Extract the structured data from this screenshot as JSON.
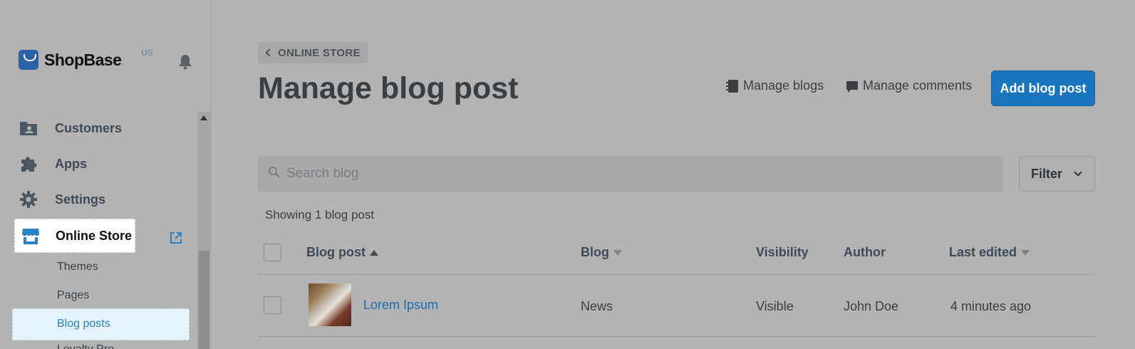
{
  "brand": {
    "name": "ShopBase",
    "region": "US"
  },
  "sidebar": {
    "items": [
      {
        "label": "Customers",
        "icon": "customers-icon"
      },
      {
        "label": "Apps",
        "icon": "apps-icon"
      },
      {
        "label": "Settings",
        "icon": "gear-icon"
      },
      {
        "label": "Online Store",
        "icon": "store-icon"
      }
    ],
    "subitems": [
      "Themes",
      "Pages",
      "Blog posts",
      "Loyalty Pro"
    ]
  },
  "header": {
    "back_label": "ONLINE STORE",
    "title": "Manage blog post",
    "manage_blogs": "Manage blogs",
    "manage_comments": "Manage comments",
    "add_button": "Add blog post"
  },
  "search": {
    "placeholder": "Search blog",
    "value": ""
  },
  "filter": {
    "label": "Filter"
  },
  "table": {
    "summary": "Showing 1 blog post",
    "columns": [
      "Blog post",
      "Blog",
      "Visibility",
      "Author",
      "Last edited"
    ],
    "rows": [
      {
        "title": "Lorem Ipsum",
        "blog": "News",
        "visibility": "Visible",
        "author": "John Doe",
        "last_edited": "4 minutes ago"
      }
    ]
  },
  "colors": {
    "primary": "#1a75bd",
    "link": "#1f6bb0",
    "overlay": "#b3b3b3",
    "selected_bg": "#e6f3fb"
  }
}
